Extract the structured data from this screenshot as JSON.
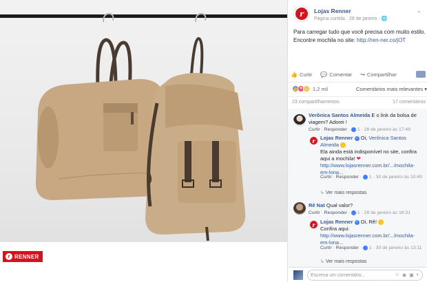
{
  "photo": {
    "brand_label": "RENNER"
  },
  "post": {
    "page_name": "Lojas Renner",
    "meta": "Página curtida · 28 de janeiro · ",
    "text": "Para carregar tudo que você precisa com muito estilo. Encontre mochila no site: ",
    "link": "http://ren-ner.co/jOT"
  },
  "actions": {
    "like": "Curtir",
    "comment": "Comentar",
    "share": "Compartilhar"
  },
  "reactions": {
    "count": "1,2 mil",
    "sort": "Comentários mais relevantes ▾"
  },
  "stats": {
    "shares": "23 compartilhamentos",
    "comments": "17 comentários"
  },
  "comments": [
    {
      "author": "Verônica Santos Almeida",
      "text": " E o link da bolsa de viagem? Adorei !",
      "like": "Curtir",
      "reply": "Responder",
      "likes": "1",
      "time": "28 de janeiro às 17:49",
      "reply_item": {
        "author": "Lojas Renner",
        "mention": "Verônica Santos Almeida",
        "text_prefix": " Oi, ",
        "text_a": "Ela ainda está indisponível no site, confira aqui a mochila!",
        "link": "http://www.lojasrenner.com.br/.../mochila-em-lona...",
        "like": "Curtir",
        "reply": "Responder",
        "likes": "1",
        "time": "30 de janeiro às 10:40"
      },
      "more": "Ver mais respostas"
    },
    {
      "author": "Rê Nat",
      "text": " Qual valor?",
      "like": "Curtir",
      "reply": "Responder",
      "likes": "1",
      "time": "28 de janeiro às 16:31",
      "reply_item": {
        "author": "Lojas Renner",
        "text_prefix": " Oi, Rê! ",
        "text_a": "Confira aqui:",
        "link": "http://www.lojasrenner.com.br/.../mochila-em-lona...",
        "like": "Curtir",
        "reply": "Responder",
        "likes": "1",
        "time": "30 de janeiro às 13:11"
      },
      "more": "Ver mais respostas"
    }
  ],
  "composer": {
    "placeholder": "Escreva um comentário..."
  }
}
